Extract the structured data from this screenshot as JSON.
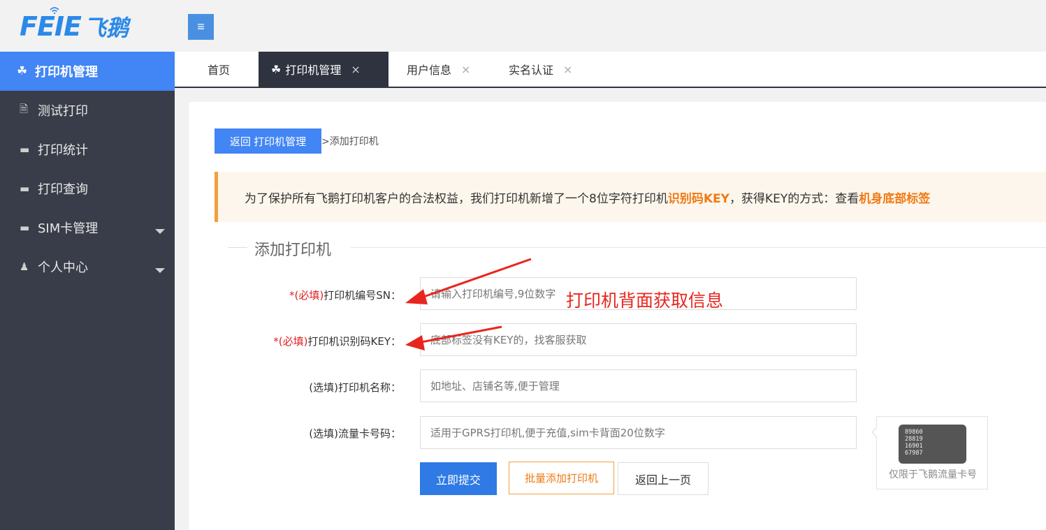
{
  "header": {
    "logo_en": "FEIE",
    "logo_cn": "飞鹅",
    "menu_icon": "hamburger-icon"
  },
  "sidebar": {
    "items": [
      {
        "label": "打印机管理",
        "icon": "printer-cluster-icon",
        "active": true
      },
      {
        "label": "测试打印",
        "icon": "document-icon"
      },
      {
        "label": "打印统计",
        "icon": "monitor-icon"
      },
      {
        "label": "打印查询",
        "icon": "monitor-icon"
      },
      {
        "label": "SIM卡管理",
        "icon": "monitor-icon",
        "expandable": true
      },
      {
        "label": "个人中心",
        "icon": "user-icon",
        "expandable": true
      }
    ]
  },
  "tabs": [
    {
      "label": "首页",
      "closable": false
    },
    {
      "label": "打印机管理",
      "closable": true,
      "active": true
    },
    {
      "label": "用户信息",
      "closable": true
    },
    {
      "label": "实名认证",
      "closable": true
    }
  ],
  "tab_close_glyph": "×",
  "breadcrumb": {
    "back_button": "返回 打印机管理",
    "current": ">添加打印机"
  },
  "notice": {
    "part1": "为了保护所有飞鹅打印机客户的合法权益，我们打印机新增了一个8位字符打印机",
    "highlight1": "识别码KEY",
    "part2": "，获得KEY的方式：查看",
    "highlight2": "机身底部标签"
  },
  "form": {
    "legend": "添加打印机",
    "required_prefix": "*(必填)",
    "fields": [
      {
        "label": "打印机编号SN：",
        "placeholder": "请输入打印机编号,9位数字",
        "required": true
      },
      {
        "label": "打印机识别码KEY：",
        "placeholder": "底部标签没有KEY的，找客服获取",
        "required": true
      },
      {
        "label": "(选填)打印机名称：",
        "placeholder": "如地址、店铺名等,便于管理",
        "required": false
      },
      {
        "label": "(选填)流量卡号码：",
        "placeholder": "适用于GPRS打印机,便于充值,sim卡背面20位数字",
        "required": false
      }
    ],
    "buttons": {
      "submit": "立即提交",
      "batch_add": "批量添加打印机",
      "back": "返回上一页"
    }
  },
  "sim_card": {
    "chip_lines": [
      "89860",
      "28819",
      "16901",
      "67987"
    ],
    "caption": "仅限于飞鹅流量卡号"
  },
  "annotation": {
    "text": "打印机背面获取信息",
    "color": "#e8261e"
  },
  "colors": {
    "primary": "#4285f4",
    "sidebar_bg": "#393d49",
    "accent_orange": "#f07a15",
    "required_red": "#e02020"
  }
}
